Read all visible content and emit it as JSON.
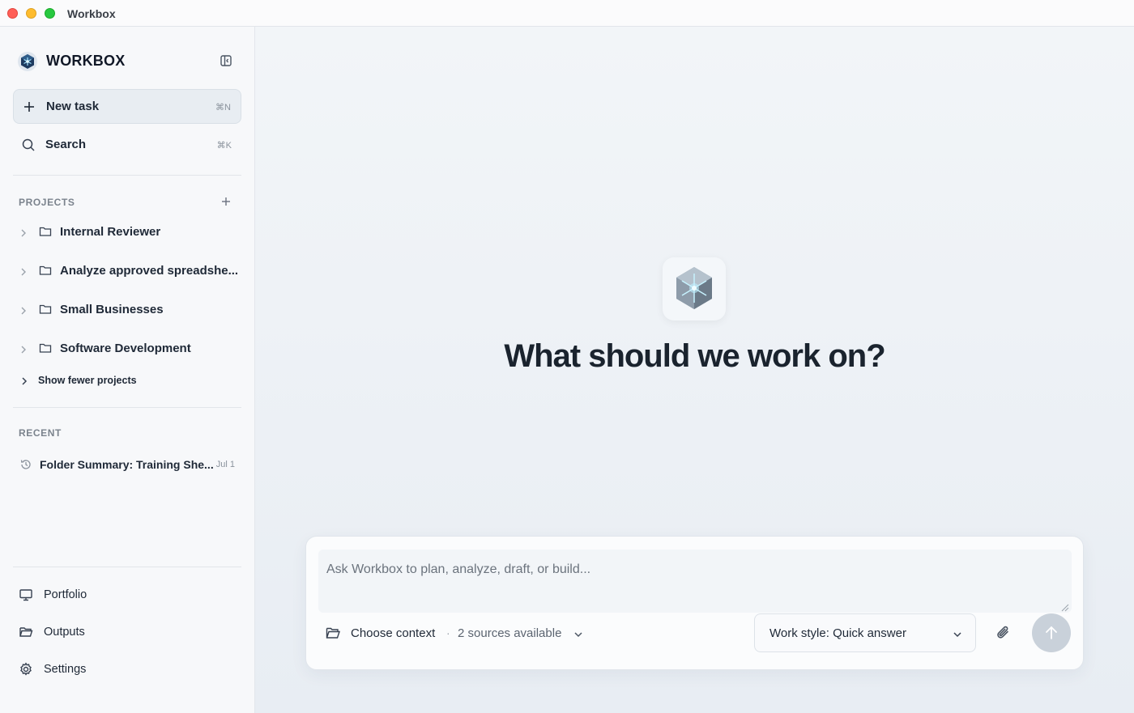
{
  "window": {
    "title": "Workbox"
  },
  "sidebar": {
    "brand": "WORKBOX",
    "new_task": {
      "label": "New task",
      "shortcut": "⌘N"
    },
    "search": {
      "label": "Search",
      "shortcut": "⌘K"
    },
    "projects_heading": "PROJECTS",
    "projects": [
      {
        "label": "Internal Reviewer",
        "icon": "folder-icon"
      },
      {
        "label": "Analyze approved spreadshe...",
        "icon": "folder-icon"
      },
      {
        "label": "Small Businesses",
        "icon": "folder-icon"
      },
      {
        "label": "Software Development",
        "icon": "folder-icon"
      }
    ],
    "show_fewer": "Show fewer projects",
    "recent_heading": "RECENT",
    "recent": [
      {
        "label": "Folder Summary: Training She...",
        "date": "Jul 1",
        "icon": "history-icon"
      }
    ],
    "bottom": [
      {
        "label": "Portfolio",
        "icon": "monitor-icon"
      },
      {
        "label": "Outputs",
        "icon": "folder-open-icon"
      },
      {
        "label": "Settings",
        "icon": "gear-icon"
      }
    ]
  },
  "main": {
    "heading": "What should we work on?",
    "composer": {
      "placeholder": "Ask Workbox to plan, analyze, draft, or build...",
      "value": "",
      "context_label": "Choose context",
      "separator": "·",
      "sources": "2 sources available",
      "work_style": "Work style: Quick answer"
    }
  },
  "colors": {
    "accent": "#1f2937",
    "sidebar_bg": "#f7f8fa",
    "main_bg": "#eef2f6",
    "send_button": "#c9d1da"
  }
}
